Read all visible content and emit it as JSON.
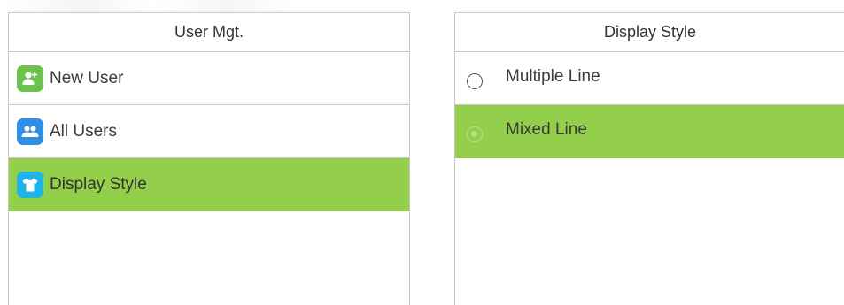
{
  "left_panel": {
    "title": "User Mgt.",
    "items": [
      {
        "label": "New User",
        "icon": "add-user-icon",
        "selected": false
      },
      {
        "label": "All Users",
        "icon": "users-icon",
        "selected": false
      },
      {
        "label": "Display Style",
        "icon": "shirt-icon",
        "selected": true
      }
    ]
  },
  "right_panel": {
    "title": "Display Style",
    "options": [
      {
        "label": "Multiple Line",
        "checked": false
      },
      {
        "label": "Mixed Line",
        "checked": true
      }
    ]
  },
  "colors": {
    "selection": "#93cf4a",
    "icon_new_user": "#6cc24a",
    "icon_all_users": "#2f8fe6",
    "icon_display_style": "#1fb3e6"
  }
}
